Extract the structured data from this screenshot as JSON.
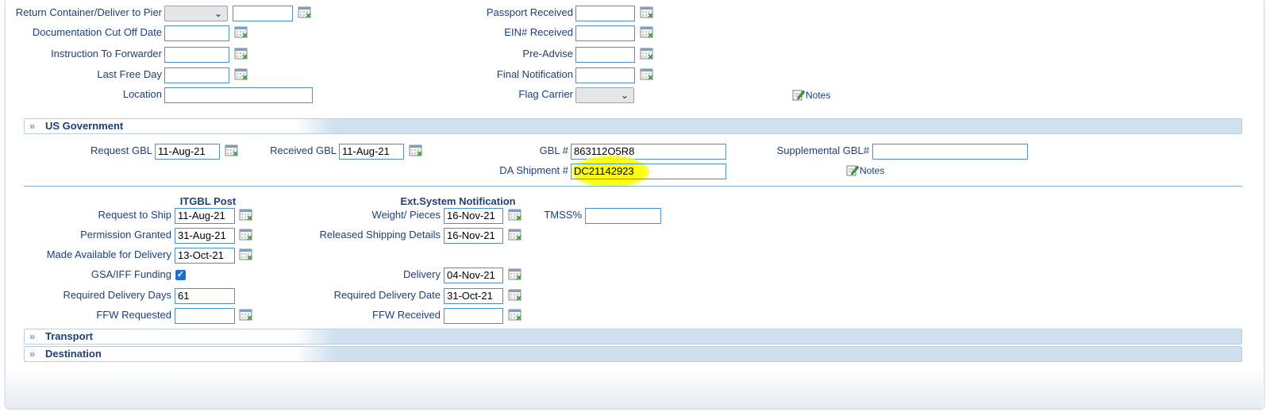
{
  "top": {
    "return_container_label": "Return Container/Deliver to Pier",
    "doc_cutoff_label": "Documentation Cut Off Date",
    "instruction_forwarder_label": "Instruction To Forwarder",
    "last_free_day_label": "Last Free Day",
    "location_label": "Location",
    "passport_received_label": "Passport Received",
    "ein_received_label": "EIN# Received",
    "pre_advise_label": "Pre-Advise",
    "final_notification_label": "Final Notification",
    "flag_carrier_label": "Flag Carrier",
    "notes_label": "Notes"
  },
  "sections": {
    "us_government": "US Government",
    "transport": "Transport",
    "destination": "Destination"
  },
  "gov": {
    "request_gbl_label": "Request GBL",
    "request_gbl_value": "11-Aug-21",
    "received_gbl_label": "Received GBL",
    "received_gbl_value": "11-Aug-21",
    "gbl_label": "GBL #",
    "gbl_value": "863112O5R8",
    "supplemental_gbl_label": "Supplemental GBL#",
    "supplemental_gbl_value": "",
    "da_shipment_label": "DA Shipment #",
    "da_shipment_value": "DC21142923",
    "notes_label": "Notes"
  },
  "itgbl": {
    "heading": "ITGBL Post",
    "request_to_ship_label": "Request to Ship",
    "request_to_ship_value": "11-Aug-21",
    "permission_granted_label": "Permission Granted",
    "permission_granted_value": "31-Aug-21",
    "made_available_label": "Made Available for Delivery",
    "made_available_value": "13-Oct-21",
    "gsa_label": "GSA/IFF Funding",
    "gsa_checked": true,
    "required_days_label": "Required Delivery Days",
    "required_days_value": "61",
    "ffw_requested_label": "FFW  Requested",
    "ffw_requested_value": ""
  },
  "ext": {
    "heading": "Ext.System Notification",
    "weight_pieces_label": "Weight/ Pieces",
    "weight_pieces_value": "16-Nov-21",
    "released_label": "Released Shipping Details",
    "released_value": "16-Nov-21",
    "delivery_label": "Delivery",
    "delivery_value": "04-Nov-21",
    "required_date_label": "Required Delivery Date",
    "required_date_value": "31-Oct-21",
    "ffw_received_label": "FFW  Received",
    "ffw_received_value": "",
    "tmss_label": "TMSS%",
    "tmss_value": ""
  },
  "colors": {
    "label": "#1f3f7a",
    "input_border": "#4f91c5",
    "section_band": "#cfe0ef",
    "highlight": "#fbff40"
  }
}
